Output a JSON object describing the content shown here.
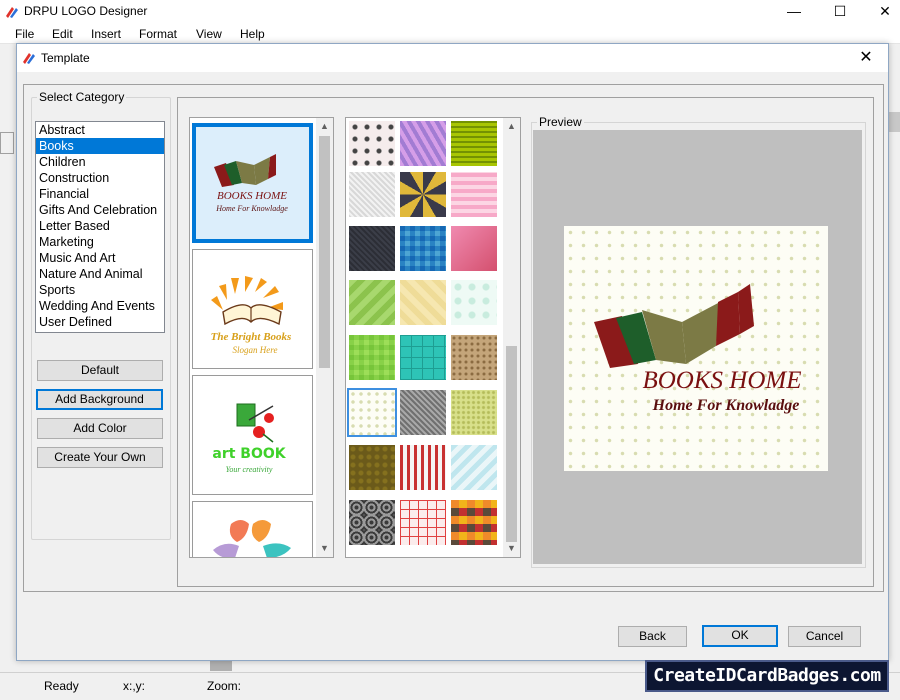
{
  "app": {
    "title": "DRPU LOGO Designer",
    "window_controls": [
      "—",
      "☐",
      "✕"
    ]
  },
  "menu": [
    "File",
    "Edit",
    "Insert",
    "Format",
    "View",
    "Help"
  ],
  "dialog": {
    "title": "Template",
    "close": "✕",
    "select_category_label": "Select Category",
    "categories": [
      "Abstract",
      "Books",
      "Children",
      "Construction",
      "Financial",
      "Gifts And Celebration",
      "Letter Based",
      "Marketing",
      "Music And Art",
      "Nature And Animal",
      "Sports",
      "Wedding And Events",
      "User Defined"
    ],
    "selected_category": "Books",
    "buttons": {
      "default": "Default",
      "add_background": "Add Background",
      "add_color": "Add Color",
      "create_your_own": "Create Your Own",
      "back": "Back",
      "ok": "OK",
      "cancel": "Cancel"
    },
    "templates": [
      {
        "title": "BOOKS HOME",
        "subtitle": "Home For Knowladge"
      },
      {
        "title": "The Bright Books",
        "subtitle": "Slogan Here"
      },
      {
        "title": "art BOOK",
        "subtitle": "Your creativity"
      },
      {
        "title": "",
        "subtitle": ""
      }
    ],
    "preview_label": "Preview",
    "preview": {
      "title": "BOOKS HOME",
      "subtitle": "Home For Knowladge"
    }
  },
  "status": {
    "ready": "Ready",
    "coords": "x:,y:",
    "zoom": "Zoom:"
  },
  "watermark": "CreateIDCardBadges.com",
  "colors": {
    "accent": "#0078d7",
    "book_dark_red": "#8b1a1a",
    "book_green": "#1e5e2a",
    "book_olive": "#7c7a45",
    "text_maroon": "#7a1010"
  },
  "icons": [
    "app-logo-icon",
    "chevron-up-icon",
    "chevron-down-icon",
    "close-icon"
  ]
}
